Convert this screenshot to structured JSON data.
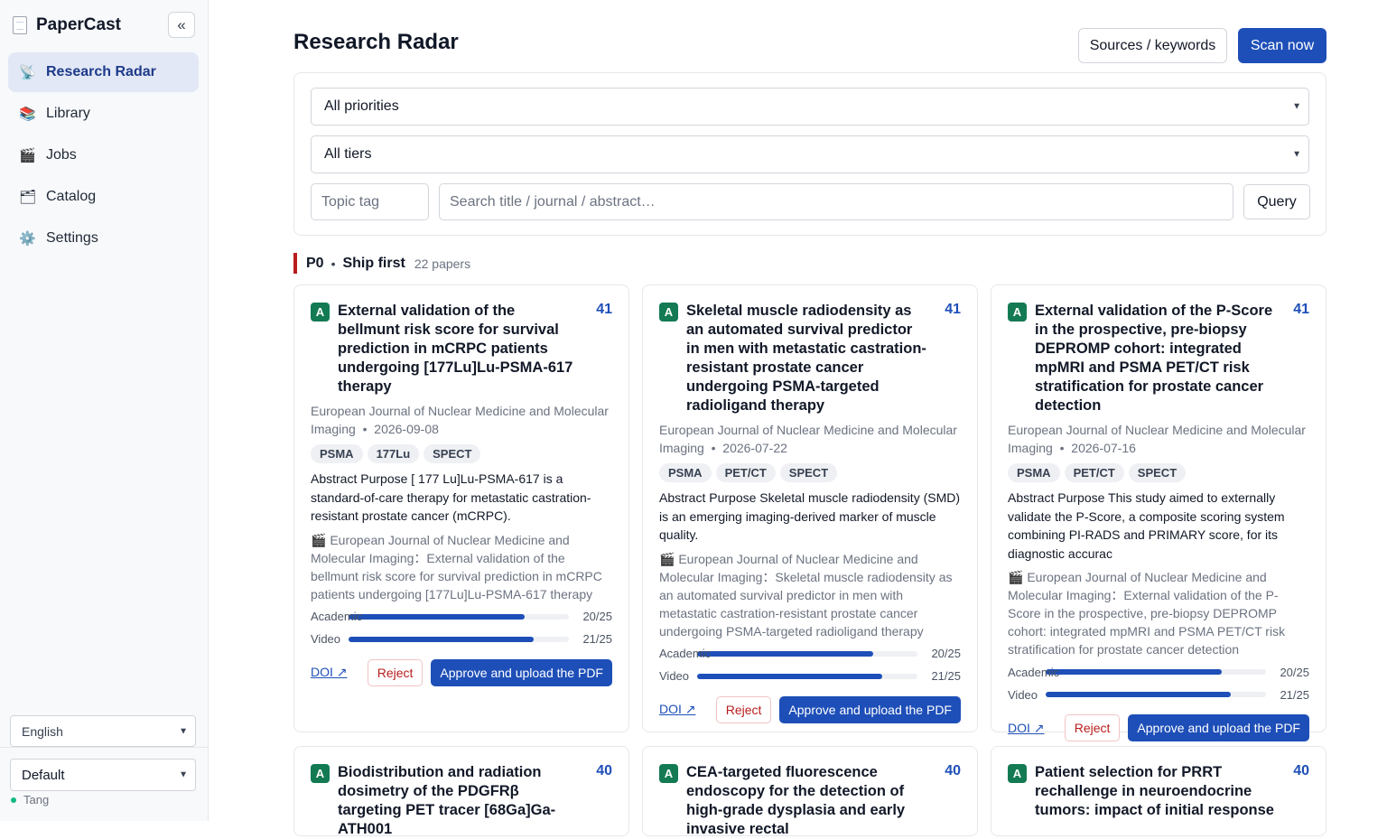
{
  "app": {
    "name": "PaperCast",
    "collapse_icon": "«"
  },
  "sidebar": {
    "items": [
      {
        "label": "Research Radar",
        "icon": "📡",
        "active": true
      },
      {
        "label": "Library",
        "icon": "📚",
        "active": false
      },
      {
        "label": "Jobs",
        "icon": "🎬",
        "active": false
      },
      {
        "label": "Catalog",
        "icon": "🗂",
        "active": false
      },
      {
        "label": "Settings",
        "icon": "⚙️",
        "active": false
      }
    ],
    "language": "English",
    "theme": "Default",
    "user": "Tang"
  },
  "header": {
    "title": "Research Radar",
    "sources_label": "Sources / keywords",
    "scan_label": "Scan now"
  },
  "filters": {
    "priority": "All priorities",
    "tier": "All tiers",
    "topic_placeholder": "Topic tag",
    "search_placeholder": "Search title / journal / abstract…",
    "query_label": "Query"
  },
  "section": {
    "priority": "P0",
    "separator": "•",
    "name": "Ship first",
    "count": "22 papers"
  },
  "cards": [
    {
      "tier": "A",
      "score": "41",
      "title": "External validation of the bellmunt risk score for survival prediction in mCRPC patients undergoing [177Lu]Lu-PSMA-617 therapy",
      "journal": "European Journal of Nuclear Medicine and Molecular Imaging",
      "date": "2026-09-08",
      "tags": [
        "PSMA",
        "177Lu",
        "SPECT"
      ],
      "abstract": "Abstract Purpose [ 177 Lu]Lu-PSMA-617 is a standard-of-care therapy for metastatic castration-resistant prostate cancer (mCRPC).",
      "video": "🎬 European Journal of Nuclear Medicine and Molecular Imaging：External validation of the bellmunt risk score for survival prediction in mCRPC patients undergoing [177Lu]Lu-PSMA-617 therapy",
      "academic_label": "Academic",
      "academic_value": "20/25",
      "academic_frac": 0.8,
      "video_label": "Video",
      "video_value": "21/25",
      "video_frac": 0.84,
      "doi": "DOI ↗",
      "reject": "Reject",
      "approve": "Approve and upload the PDF"
    },
    {
      "tier": "A",
      "score": "41",
      "title": "Skeletal muscle radiodensity as an automated survival predictor in men with metastatic castration-resistant prostate cancer undergoing PSMA-targeted radioligand therapy",
      "journal": "European Journal of Nuclear Medicine and Molecular Imaging",
      "date": "2026-07-22",
      "tags": [
        "PSMA",
        "PET/CT",
        "SPECT"
      ],
      "abstract": "Abstract Purpose Skeletal muscle radiodensity (SMD) is an emerging imaging-derived marker of muscle quality.",
      "video": "🎬 European Journal of Nuclear Medicine and Molecular Imaging：Skeletal muscle radiodensity as an automated survival predictor in men with metastatic castration-resistant prostate cancer undergoing PSMA-targeted radioligand therapy",
      "academic_label": "Academic",
      "academic_value": "20/25",
      "academic_frac": 0.8,
      "video_label": "Video",
      "video_value": "21/25",
      "video_frac": 0.84,
      "doi": "DOI ↗",
      "reject": "Reject",
      "approve": "Approve and upload the PDF"
    },
    {
      "tier": "A",
      "score": "41",
      "title": "External validation of the P-Score in the prospective, pre-biopsy DEPROMP cohort: integrated mpMRI and PSMA PET/CT risk stratification for prostate cancer detection",
      "journal": "European Journal of Nuclear Medicine and Molecular Imaging",
      "date": "2026-07-16",
      "tags": [
        "PSMA",
        "PET/CT",
        "SPECT"
      ],
      "abstract": "Abstract Purpose This study aimed to externally validate the P-Score, a composite scoring system combining PI-RADS and PRIMARY score, for its diagnostic accurac",
      "video": "🎬 European Journal of Nuclear Medicine and Molecular Imaging：External validation of the P-Score in the prospective, pre-biopsy DEPROMP cohort: integrated mpMRI and PSMA PET/CT risk stratification for prostate cancer detection",
      "academic_label": "Academic",
      "academic_value": "20/25",
      "academic_frac": 0.8,
      "video_label": "Video",
      "video_value": "21/25",
      "video_frac": 0.84,
      "doi": "DOI ↗",
      "reject": "Reject",
      "approve": "Approve and upload the PDF"
    },
    {
      "tier": "A",
      "score": "40",
      "title": "Biodistribution and radiation dosimetry of the PDGFRβ targeting PET tracer [68Ga]Ga-ATH001"
    },
    {
      "tier": "A",
      "score": "40",
      "title": "CEA-targeted fluorescence endoscopy for the detection of high-grade dysplasia and early invasive rectal"
    },
    {
      "tier": "A",
      "score": "40",
      "title": "Patient selection for PRRT rechallenge in neuroendocrine tumors: impact of initial response"
    }
  ]
}
